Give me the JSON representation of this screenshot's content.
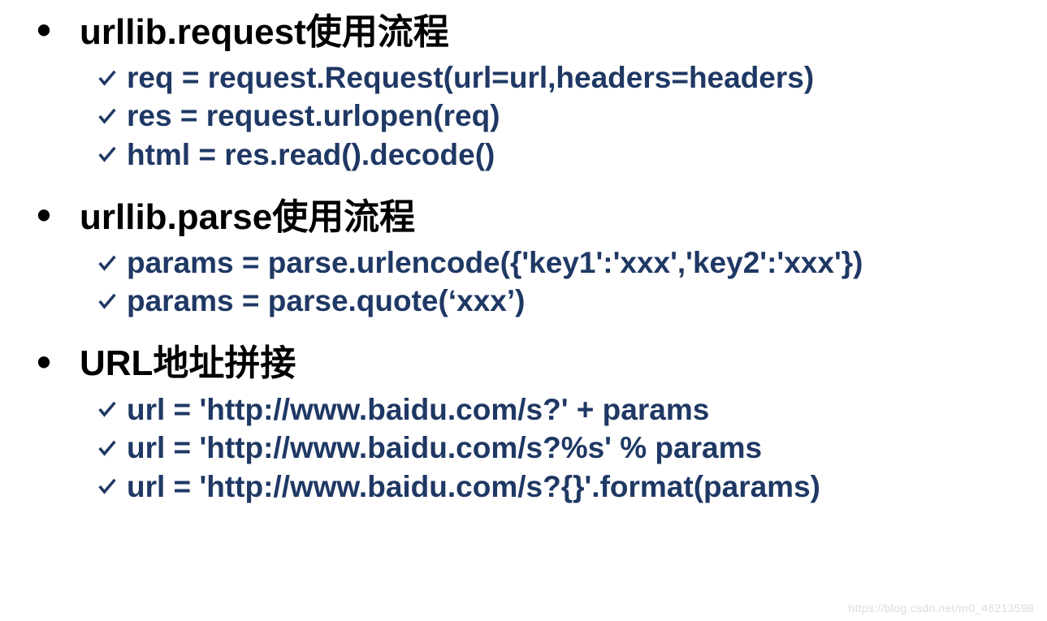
{
  "sections": [
    {
      "heading": "urllib.request使用流程",
      "items": [
        "req = request.Request(url=url,headers=headers)",
        "res = request.urlopen(req)",
        "html = res.read().decode()"
      ]
    },
    {
      "heading": "urllib.parse使用流程",
      "items": [
        "params = parse.urlencode({'key1':'xxx','key2':'xxx'})",
        "params = parse.quote(‘xxx’)"
      ]
    },
    {
      "heading": "URL地址拼接",
      "items": [
        "url = 'http://www.baidu.com/s?' + params",
        "url = 'http://www.baidu.com/s?%s' % params",
        "url = 'http://www.baidu.com/s?{}'.format(params)"
      ]
    }
  ],
  "watermark": "https://blog.csdn.net/m0_46213598",
  "bullet_char": "•"
}
